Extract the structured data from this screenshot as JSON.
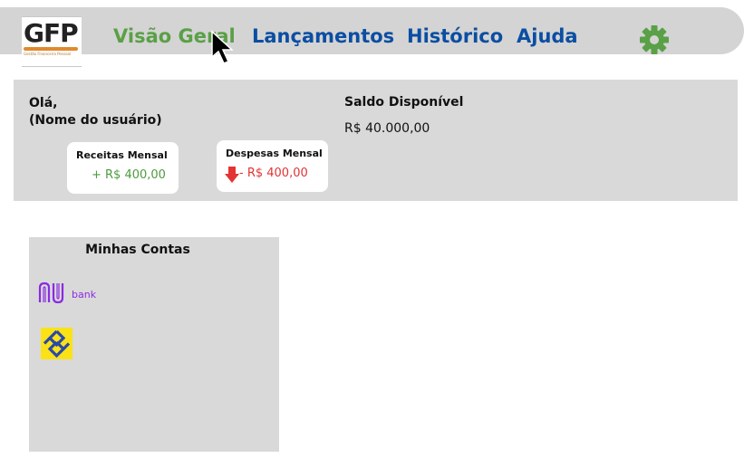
{
  "app": {
    "logo_text": "GFP",
    "logo_tagline": "Gestão Financeira Pessoal"
  },
  "nav": {
    "items": [
      {
        "label": "Visão Geral",
        "active": true
      },
      {
        "label": "Lançamentos",
        "active": false
      },
      {
        "label": "Histórico",
        "active": false
      },
      {
        "label": "Ajuda",
        "active": false
      }
    ],
    "settings_icon": "gear-icon"
  },
  "summary": {
    "greeting_line1": "Olá,",
    "greeting_line2": "(Nome do usuário)",
    "balance_label": "Saldo Disponível",
    "balance_value": "R$ 40.000,00",
    "income": {
      "title": "Receitas Mensal",
      "value": "+ R$ 400,00"
    },
    "expense": {
      "title": "Despesas Mensal",
      "value": "- R$ 400,00"
    }
  },
  "accounts": {
    "title": "Minhas Contas",
    "items": [
      {
        "name": "nubank",
        "logo_text": "bank"
      },
      {
        "name": "banco-do-brasil"
      }
    ]
  },
  "colors": {
    "nav_active": "#5aa046",
    "nav_link": "#0b4ea2",
    "income": "#4e9a3e",
    "expense": "#e33333",
    "panel_bg": "#d9d9d9",
    "nubank": "#8a2be2",
    "bb_yellow": "#fbe216",
    "bb_blue": "#2a4aa8"
  }
}
